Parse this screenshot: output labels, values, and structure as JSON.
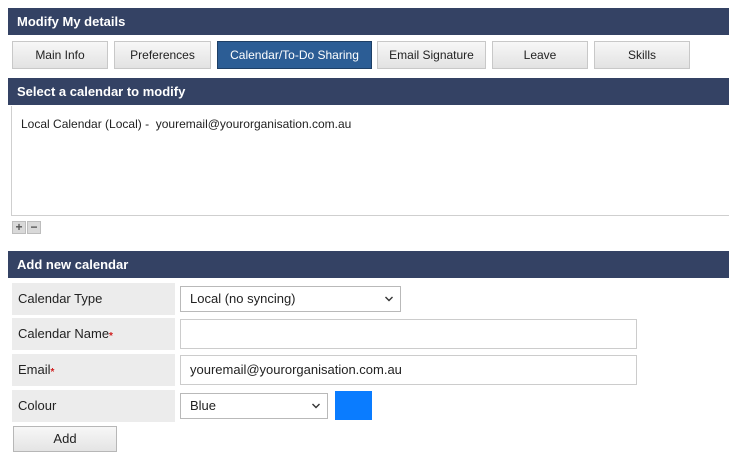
{
  "headers": {
    "modify": "Modify My details",
    "select": "Select a calendar to modify",
    "add": "Add new calendar"
  },
  "tabs": [
    {
      "label": "Main Info",
      "active": false
    },
    {
      "label": "Preferences",
      "active": false
    },
    {
      "label": "Calendar/To-Do Sharing",
      "active": true
    },
    {
      "label": "Email Signature",
      "active": false
    },
    {
      "label": "Leave",
      "active": false
    },
    {
      "label": "Skills",
      "active": false
    }
  ],
  "calendar_list": {
    "items": [
      "Local Calendar (Local) -  youremail@yourorganisation.com.au"
    ],
    "add_symbol": "+",
    "remove_symbol": "−"
  },
  "form": {
    "calendar_type": {
      "label": "Calendar Type",
      "value": "Local (no syncing)"
    },
    "calendar_name": {
      "label": "Calendar Name",
      "required_mark": "*",
      "value": ""
    },
    "email": {
      "label": "Email",
      "required_mark": "*",
      "value": "youremail@yourorganisation.com.au"
    },
    "colour": {
      "label": "Colour",
      "value": "Blue",
      "swatch_color": "#0a7cff"
    },
    "add_button": "Add"
  },
  "colors": {
    "header_bg": "#344264",
    "active_tab_bg": "#2c5d95",
    "required_mark": "#d01f1f"
  }
}
